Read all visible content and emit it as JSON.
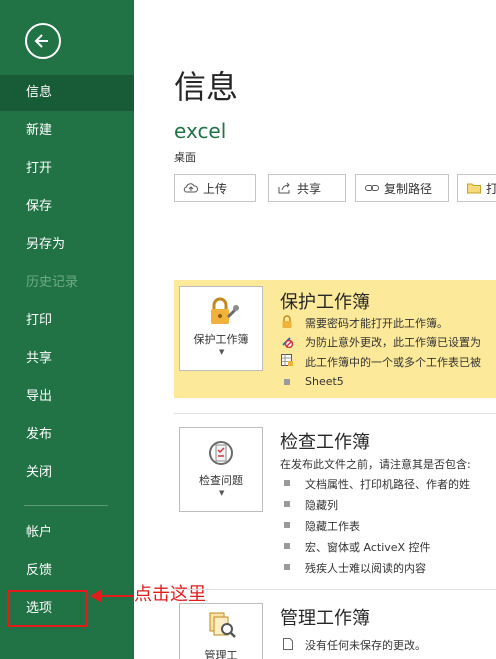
{
  "sidebar": {
    "items": [
      {
        "label": "信息"
      },
      {
        "label": "新建"
      },
      {
        "label": "打开"
      },
      {
        "label": "保存"
      },
      {
        "label": "另存为"
      },
      {
        "label": "历史记录"
      },
      {
        "label": "打印"
      },
      {
        "label": "共享"
      },
      {
        "label": "导出"
      },
      {
        "label": "发布"
      },
      {
        "label": "关闭"
      },
      {
        "label": "帐户"
      },
      {
        "label": "反馈"
      },
      {
        "label": "选项"
      }
    ]
  },
  "annotation": {
    "text": "点击这里"
  },
  "main": {
    "title": "信息",
    "file_name": "excel",
    "file_location": "桌面",
    "toolbar": [
      {
        "label": "上传",
        "icon": "upload-icon"
      },
      {
        "label": "共享",
        "icon": "share-icon"
      },
      {
        "label": "复制路径",
        "icon": "link-icon"
      },
      {
        "label": "打",
        "icon": "folder-icon"
      }
    ],
    "protect": {
      "button_label": "保护工作簿",
      "title": "保护工作簿",
      "lines": [
        "需要密码才能打开此工作簿。",
        "为防止意外更改，此工作簿已设置为",
        "此工作簿中的一个或多个工作表已被"
      ],
      "sheet": "Sheet5"
    },
    "inspect": {
      "button_label": "检查问题",
      "title": "检查工作簿",
      "intro": "在发布此文件之前，请注意其是否包含:",
      "items": [
        "文档属性、打印机路径、作者的姓",
        "隐藏列",
        "隐藏工作表",
        "宏、窗体或 ActiveX 控件",
        "残疾人士难以阅读的内容"
      ]
    },
    "manage": {
      "button_label": "管理工",
      "title": "管理工作簿",
      "line": "没有任何未保存的更改。"
    }
  },
  "colors": {
    "accent": "#217346",
    "highlight": "#fde99a",
    "annotation": "#e31b1b"
  }
}
